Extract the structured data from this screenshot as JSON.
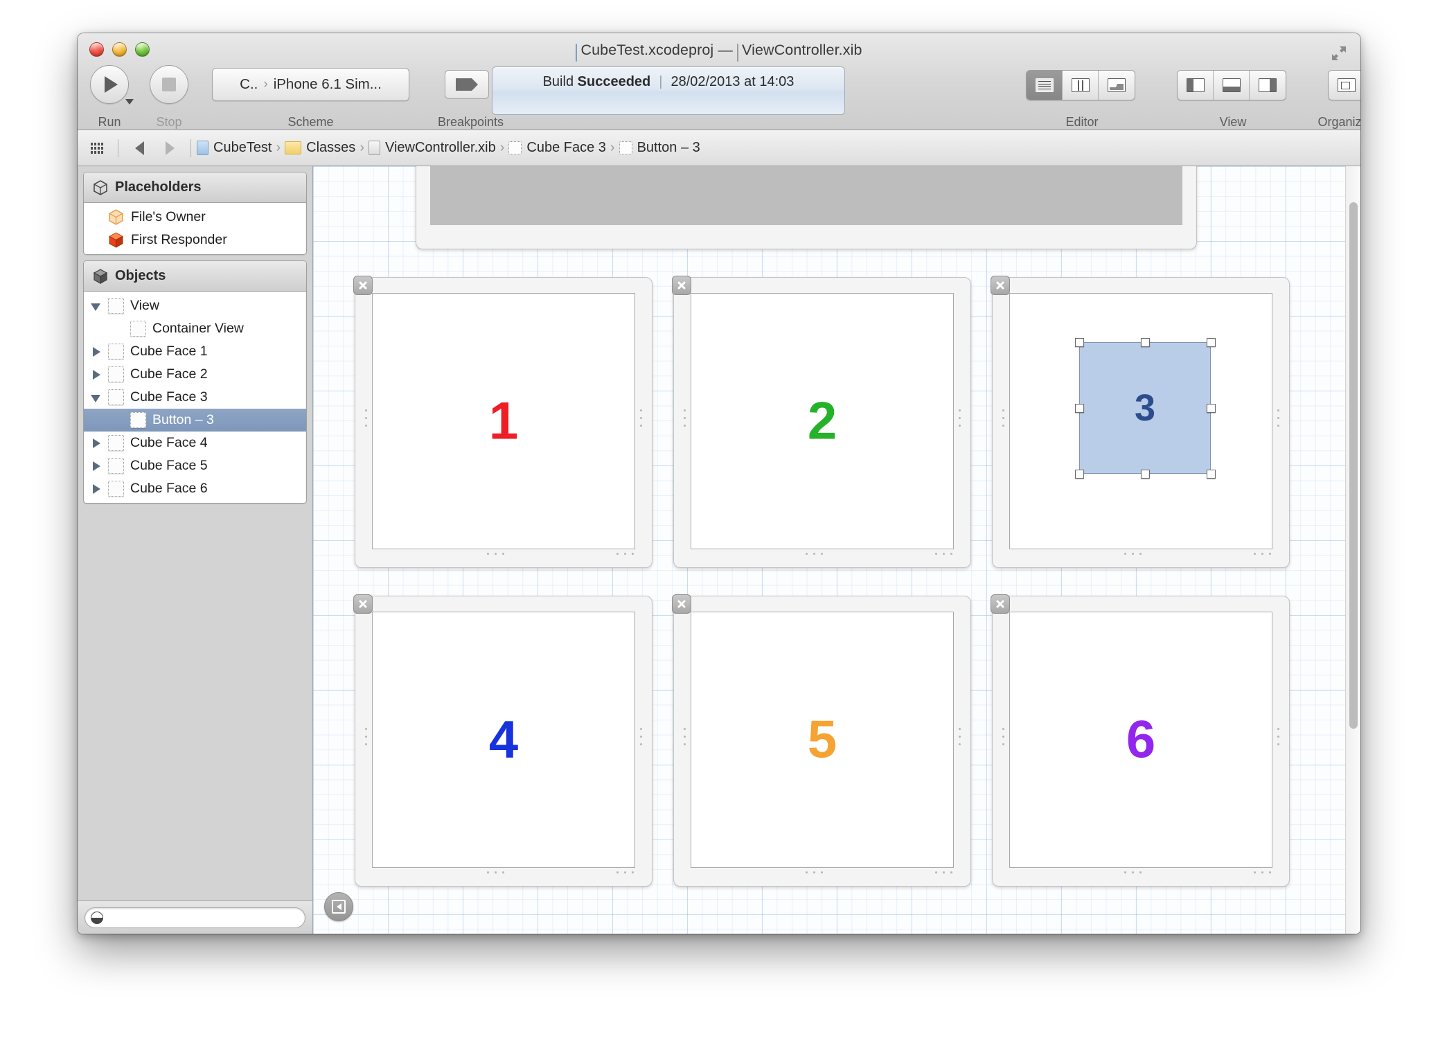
{
  "window": {
    "title_project": "CubeTest.xcodeproj",
    "title_separator": "—",
    "title_document": "ViewController.xib",
    "traffic_lights": [
      "close",
      "minimize",
      "zoom"
    ]
  },
  "toolbar": {
    "run_label": "Run",
    "stop_label": "Stop",
    "scheme_label": "Scheme",
    "scheme_project": "C..",
    "scheme_separator": "›",
    "scheme_destination": "iPhone 6.1 Sim...",
    "breakpoints_label": "Breakpoints",
    "editor_label": "Editor",
    "view_label": "View",
    "organizer_label": "Organizer",
    "activity": {
      "build_word": "Build",
      "status": "Succeeded",
      "divider": "|",
      "timestamp": "28/02/2013 at 14:03"
    }
  },
  "jumpbar": {
    "crumbs": [
      {
        "label": "CubeTest",
        "icon": "project-icon"
      },
      {
        "label": "Classes",
        "icon": "folder-icon"
      },
      {
        "label": "ViewController.xib",
        "icon": "xib-icon"
      },
      {
        "label": "Cube Face 3",
        "icon": "view-icon"
      },
      {
        "label": "Button – 3",
        "icon": "view-icon"
      }
    ],
    "chevron": "›"
  },
  "sidebar": {
    "placeholders": {
      "title": "Placeholders",
      "items": [
        {
          "label": "File's Owner",
          "icon": "files-owner-icon"
        },
        {
          "label": "First Responder",
          "icon": "first-responder-icon"
        }
      ]
    },
    "objects": {
      "title": "Objects",
      "items": [
        {
          "label": "View",
          "indent": 0,
          "twisty": "open",
          "icon": "view-icon",
          "selected": false
        },
        {
          "label": "Container View",
          "indent": 1,
          "twisty": "none",
          "icon": "view-icon",
          "selected": false
        },
        {
          "label": "Cube Face 1",
          "indent": 0,
          "twisty": "closed",
          "icon": "view-icon",
          "selected": false
        },
        {
          "label": "Cube Face 2",
          "indent": 0,
          "twisty": "closed",
          "icon": "view-icon",
          "selected": false
        },
        {
          "label": "Cube Face 3",
          "indent": 0,
          "twisty": "open",
          "icon": "view-icon",
          "selected": false
        },
        {
          "label": "Button – 3",
          "indent": 1,
          "twisty": "none",
          "icon": "view-icon",
          "selected": true
        },
        {
          "label": "Cube Face 4",
          "indent": 0,
          "twisty": "closed",
          "icon": "view-icon",
          "selected": false
        },
        {
          "label": "Cube Face 5",
          "indent": 0,
          "twisty": "closed",
          "icon": "view-icon",
          "selected": false
        },
        {
          "label": "Cube Face 6",
          "indent": 0,
          "twisty": "closed",
          "icon": "view-icon",
          "selected": false
        }
      ]
    },
    "filter_placeholder": ""
  },
  "canvas": {
    "cards": [
      {
        "number": "1",
        "color": "#ef1d26",
        "col": 0,
        "row": 0,
        "selected": false
      },
      {
        "number": "2",
        "color": "#24b22a",
        "col": 1,
        "row": 0,
        "selected": false
      },
      {
        "number": "3",
        "color": "#2b4d8c",
        "col": 2,
        "row": 0,
        "selected": true
      },
      {
        "number": "4",
        "color": "#1633dd",
        "col": 0,
        "row": 1,
        "selected": false
      },
      {
        "number": "5",
        "color": "#f5a332",
        "col": 1,
        "row": 1,
        "selected": false
      },
      {
        "number": "6",
        "color": "#9326ed",
        "col": 2,
        "row": 1,
        "selected": false
      }
    ],
    "selected_button_label": "3",
    "selected_button_fill": "#b9cce8",
    "selection_handle_count": 8
  }
}
